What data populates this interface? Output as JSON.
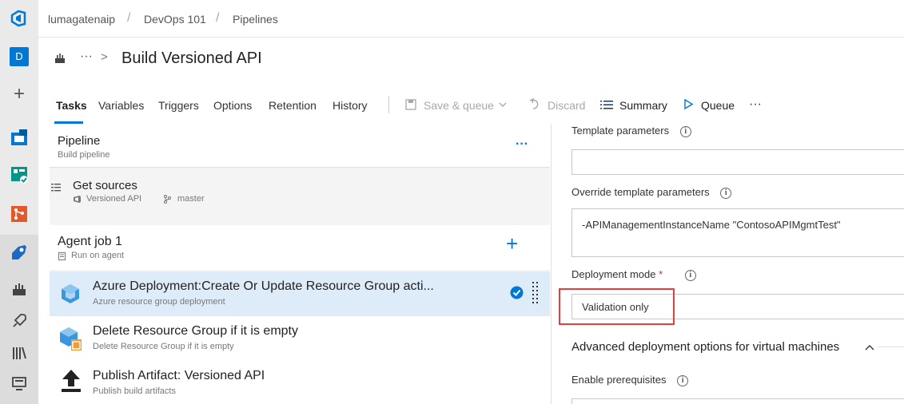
{
  "breadcrumb": {
    "org": "lumagatenaip",
    "project": "DevOps 101",
    "section": "Pipelines"
  },
  "rail": {
    "avatar_letter": "D"
  },
  "title": {
    "more": "···",
    "chevron": ">",
    "text": "Build Versioned API"
  },
  "tabs": [
    "Tasks",
    "Variables",
    "Triggers",
    "Options",
    "Retention",
    "History"
  ],
  "toolbar": {
    "save_queue": "Save & queue",
    "discard": "Discard",
    "summary": "Summary",
    "queue": "Queue",
    "more": "···"
  },
  "pipeline": {
    "title": "Pipeline",
    "subtitle": "Build pipeline",
    "more": "···"
  },
  "get_sources": {
    "title": "Get sources",
    "repo": "Versioned API",
    "branch": "master"
  },
  "agent_job": {
    "title": "Agent job 1",
    "subtitle": "Run on agent",
    "add": "+"
  },
  "tasks": [
    {
      "title": "Azure Deployment:Create Or Update Resource Group acti...",
      "subtitle": "Azure resource group deployment"
    },
    {
      "title": "Delete Resource Group if it is empty",
      "subtitle": "Delete Resource Group if it is empty"
    },
    {
      "title": "Publish Artifact: Versioned API",
      "subtitle": "Publish build artifacts"
    }
  ],
  "form": {
    "template_parameters_label": "Template parameters",
    "template_parameters_value": "",
    "override_label": "Override template parameters",
    "override_value": "-APIManagementInstanceName \"ContosoAPIMgmtTest\"",
    "deployment_mode_label": "Deployment mode",
    "required_mark": "*",
    "deployment_mode_value": "Validation only",
    "advanced_section": "Advanced deployment options for virtual machines",
    "enable_prereq_label": "Enable prerequisites",
    "info_glyph": "i"
  },
  "colors": {
    "accent": "#0078d4",
    "highlight": "#e04040",
    "selected_row": "#deecf9"
  }
}
